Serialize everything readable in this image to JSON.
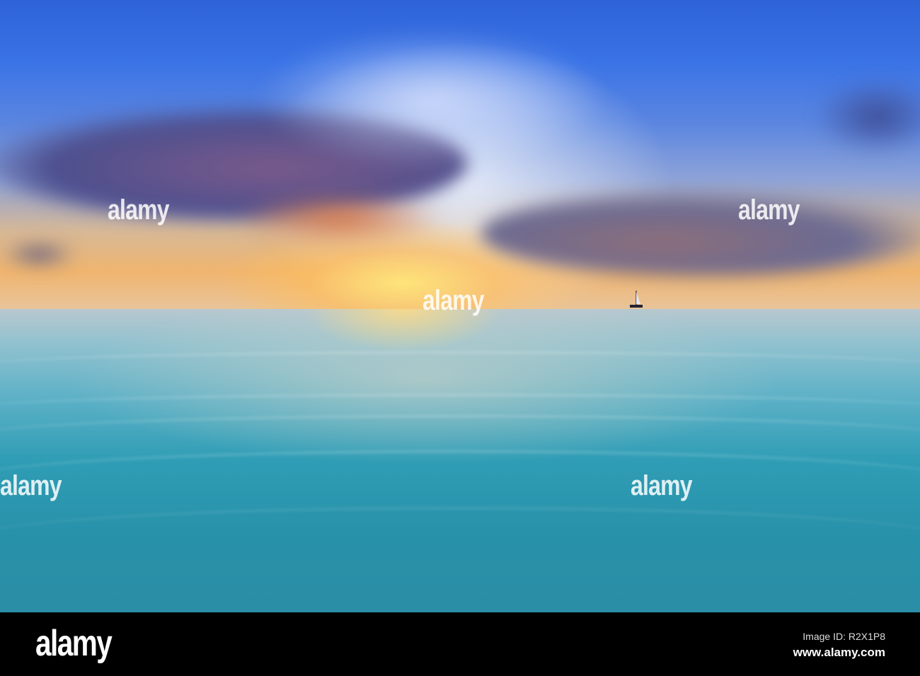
{
  "photo": {
    "description_colors": {
      "sky_top": "#2e63d8",
      "horizon": "#f0b56f",
      "water": "#2a8ea6"
    },
    "watermark": "alamy"
  },
  "footer": {
    "logo": "alamy",
    "image_id": "Image ID: R2X1P8",
    "website": "www.alamy.com"
  }
}
